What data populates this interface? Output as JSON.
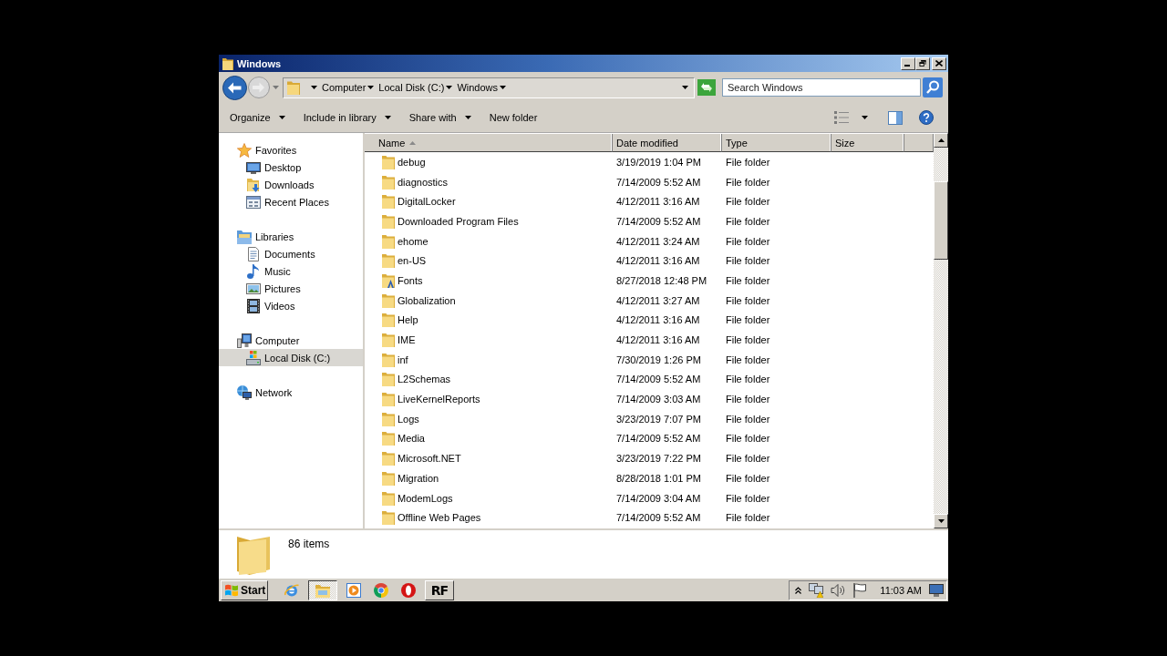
{
  "window": {
    "title": "Windows"
  },
  "navigation": {
    "back": {
      "disabled": false
    },
    "forward": {
      "disabled": true
    }
  },
  "address": {
    "crumbs": [
      "Computer",
      "Local Disk (C:)",
      "Windows"
    ]
  },
  "search": {
    "placeholder": "Search Windows"
  },
  "toolbar": {
    "items": [
      {
        "label": "Organize",
        "dropdown": true
      },
      {
        "label": "Include in library",
        "dropdown": true
      },
      {
        "label": "Share with",
        "dropdown": true
      },
      {
        "label": "New folder",
        "dropdown": false
      }
    ]
  },
  "sidebar": {
    "items": [
      {
        "label": "Favorites",
        "kind": "favorites",
        "selected": false,
        "children": [
          {
            "label": "Desktop",
            "kind": "desktop",
            "selected": false
          },
          {
            "label": "Downloads",
            "kind": "downloads",
            "selected": false
          },
          {
            "label": "Recent Places",
            "kind": "recent",
            "selected": false
          }
        ]
      },
      {
        "label": "Libraries",
        "kind": "libraries",
        "selected": false,
        "children": [
          {
            "label": "Documents",
            "kind": "documents",
            "selected": false
          },
          {
            "label": "Music",
            "kind": "music",
            "selected": false
          },
          {
            "label": "Pictures",
            "kind": "pictures",
            "selected": false
          },
          {
            "label": "Videos",
            "kind": "videos",
            "selected": false
          }
        ]
      },
      {
        "label": "Computer",
        "kind": "computer",
        "selected": false,
        "children": [
          {
            "label": "Local Disk (C:)",
            "kind": "drive",
            "selected": true
          }
        ]
      },
      {
        "label": "Network",
        "kind": "network",
        "selected": false
      }
    ]
  },
  "table": {
    "columns": [
      {
        "label": "Name",
        "sorted": true
      },
      {
        "label": "Date modified",
        "sorted": false
      },
      {
        "label": "Type",
        "sorted": false
      },
      {
        "label": "Size",
        "sorted": false
      }
    ],
    "rows": [
      {
        "name": "debug",
        "date": "3/19/2019 1:04 PM",
        "type": "File folder",
        "kind": "folder"
      },
      {
        "name": "diagnostics",
        "date": "7/14/2009 5:52 AM",
        "type": "File folder",
        "kind": "folder"
      },
      {
        "name": "DigitalLocker",
        "date": "4/12/2011 3:16 AM",
        "type": "File folder",
        "kind": "folder"
      },
      {
        "name": "Downloaded Program Files",
        "date": "7/14/2009 5:52 AM",
        "type": "File folder",
        "kind": "folder"
      },
      {
        "name": "ehome",
        "date": "4/12/2011 3:24 AM",
        "type": "File folder",
        "kind": "folder"
      },
      {
        "name": "en-US",
        "date": "4/12/2011 3:16 AM",
        "type": "File folder",
        "kind": "folder"
      },
      {
        "name": "Fonts",
        "date": "8/27/2018 12:48 PM",
        "type": "File folder",
        "kind": "fonts"
      },
      {
        "name": "Globalization",
        "date": "4/12/2011 3:27 AM",
        "type": "File folder",
        "kind": "folder"
      },
      {
        "name": "Help",
        "date": "4/12/2011 3:16 AM",
        "type": "File folder",
        "kind": "folder"
      },
      {
        "name": "IME",
        "date": "4/12/2011 3:16 AM",
        "type": "File folder",
        "kind": "folder"
      },
      {
        "name": "inf",
        "date": "7/30/2019 1:26 PM",
        "type": "File folder",
        "kind": "folder"
      },
      {
        "name": "L2Schemas",
        "date": "7/14/2009 5:52 AM",
        "type": "File folder",
        "kind": "folder"
      },
      {
        "name": "LiveKernelReports",
        "date": "7/14/2009 3:03 AM",
        "type": "File folder",
        "kind": "folder"
      },
      {
        "name": "Logs",
        "date": "3/23/2019 7:07 PM",
        "type": "File folder",
        "kind": "folder"
      },
      {
        "name": "Media",
        "date": "7/14/2009 5:52 AM",
        "type": "File folder",
        "kind": "folder"
      },
      {
        "name": "Microsoft.NET",
        "date": "3/23/2019 7:22 PM",
        "type": "File folder",
        "kind": "folder"
      },
      {
        "name": "Migration",
        "date": "8/28/2018 1:01 PM",
        "type": "File folder",
        "kind": "folder"
      },
      {
        "name": "ModemLogs",
        "date": "7/14/2009 3:04 AM",
        "type": "File folder",
        "kind": "folder"
      },
      {
        "name": "Offline Web Pages",
        "date": "7/14/2009 5:52 AM",
        "type": "File folder",
        "kind": "folder"
      }
    ]
  },
  "details": {
    "count": "86 items"
  },
  "taskbar": {
    "start": "Start",
    "items": [
      {
        "kind": "globe",
        "running": false,
        "selected": false
      },
      {
        "kind": "folder",
        "running": true,
        "selected": true
      },
      {
        "kind": "play",
        "running": false,
        "selected": false
      },
      {
        "kind": "circle",
        "running": false,
        "selected": false
      },
      {
        "kind": "ring",
        "running": false,
        "selected": false
      },
      {
        "kind": "label",
        "label": "RF",
        "running": true,
        "selected": false
      }
    ],
    "time": "11:03 AM"
  }
}
